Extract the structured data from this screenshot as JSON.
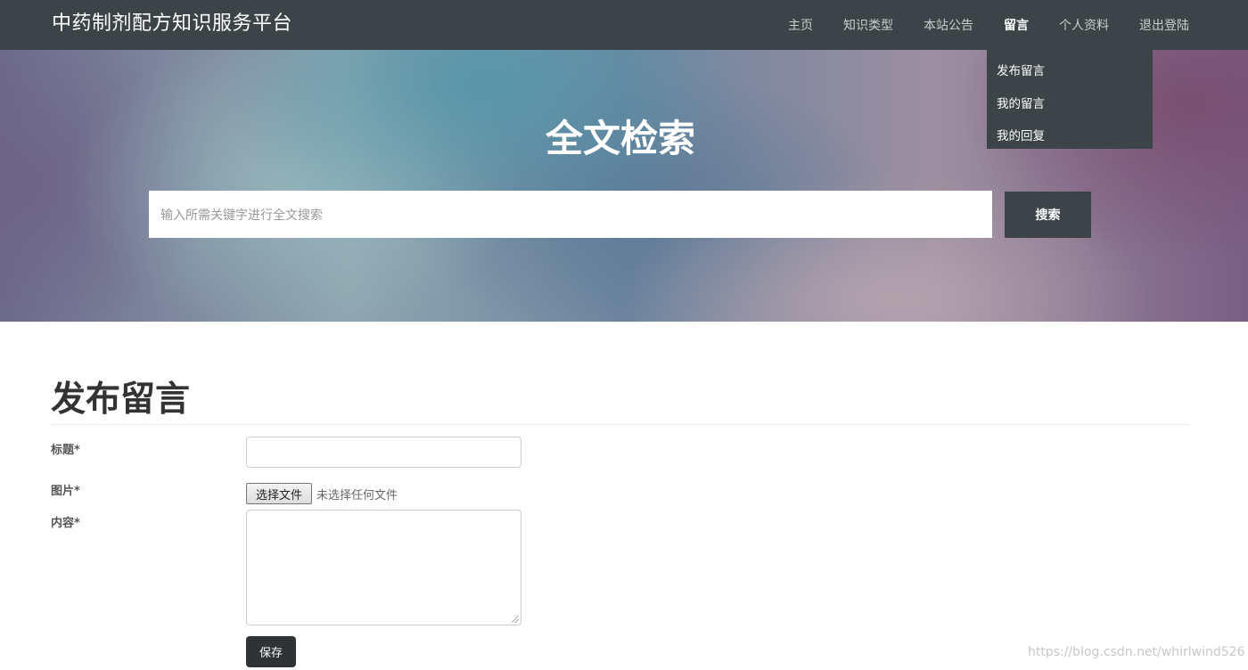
{
  "navbar": {
    "brand": "中药制剂配方知识服务平台",
    "items": [
      {
        "label": "主页"
      },
      {
        "label": "知识类型"
      },
      {
        "label": "本站公告"
      },
      {
        "label": "留言"
      },
      {
        "label": "个人资料"
      },
      {
        "label": "退出登陆"
      }
    ],
    "active_item": "留言"
  },
  "dropdown": {
    "items": [
      {
        "label": "发布留言"
      },
      {
        "label": "我的留言"
      },
      {
        "label": "我的回复"
      }
    ]
  },
  "hero": {
    "title": "全文检索",
    "search_placeholder": "输入所需关键字进行全文搜索",
    "search_button": "搜索"
  },
  "form": {
    "title": "发布留言",
    "fields": {
      "title_label": "标题*",
      "image_label": "图片*",
      "content_label": "内容*"
    },
    "file_button": "选择文件",
    "file_status": "未选择任何文件",
    "save_button": "保存"
  },
  "watermark": "https://blog.csdn.net/whirlwind526",
  "colors": {
    "navbar_bg": "#3c4448",
    "button_dark": "#2f3336",
    "hero_text": "#ffffff"
  }
}
